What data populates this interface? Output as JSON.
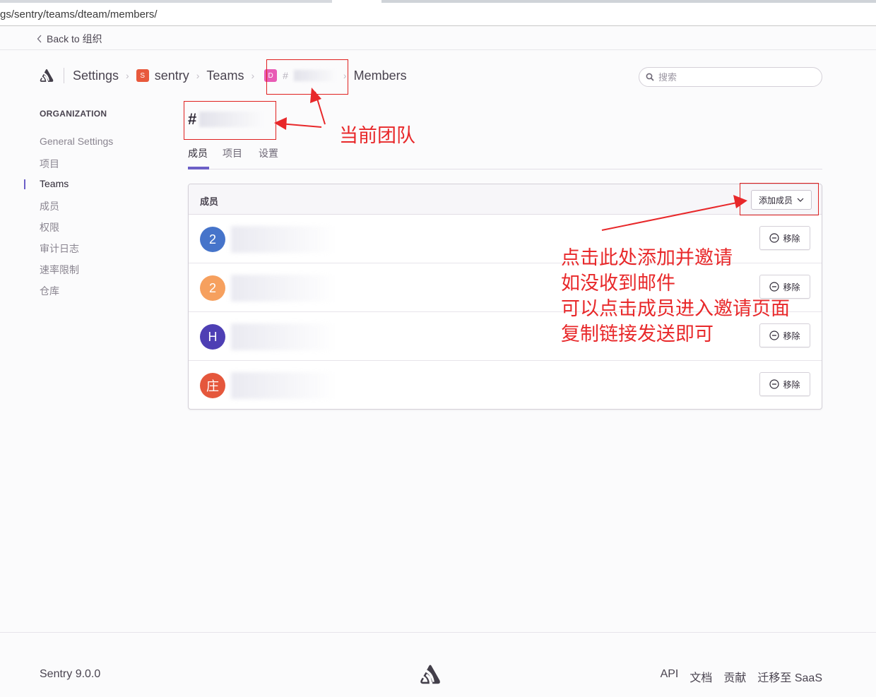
{
  "browser": {
    "url": "gs/sentry/teams/dteam/members/"
  },
  "backbar": {
    "label": "Back to 组织"
  },
  "breadcrumb": {
    "settings": "Settings",
    "org_badge": "S",
    "org": "sentry",
    "teams": "Teams",
    "team_badge": "D",
    "team_hash": "#",
    "members": "Members"
  },
  "search": {
    "placeholder": "搜索"
  },
  "sidebar": {
    "heading": "ORGANIZATION",
    "items": [
      {
        "label": "General Settings",
        "active": false
      },
      {
        "label": "项目",
        "active": false
      },
      {
        "label": "Teams",
        "active": true
      },
      {
        "label": "成员",
        "active": false
      },
      {
        "label": "权限",
        "active": false
      },
      {
        "label": "审计日志",
        "active": false
      },
      {
        "label": "速率限制",
        "active": false
      },
      {
        "label": "仓库",
        "active": false
      }
    ]
  },
  "team": {
    "title": "#",
    "tabs": [
      {
        "label": "成员",
        "active": true
      },
      {
        "label": "项目",
        "active": false
      },
      {
        "label": "设置",
        "active": false
      }
    ]
  },
  "members_panel": {
    "title": "成员",
    "add_button": "添加成员",
    "remove_label": "移除",
    "rows": [
      {
        "initial": "2",
        "color": "#4674ca"
      },
      {
        "initial": "2",
        "color": "#f6a05e"
      },
      {
        "initial": "H",
        "color": "#4e3fb4"
      },
      {
        "initial": "庄",
        "color": "#e5573c"
      }
    ]
  },
  "annotations": {
    "current_team": "当前团队",
    "instructions": [
      "点击此处添加并邀请",
      "如没收到邮件",
      "可以点击成员进入邀请页面",
      "复制链接发送即可"
    ],
    "color": "#e8282a"
  },
  "footer": {
    "version": "Sentry 9.0.0",
    "links": [
      "API",
      "文档",
      "贡献",
      "迁移至 SaaS"
    ]
  },
  "colors": {
    "accent": "#6c5fc7",
    "border": "#d4d0d8",
    "text": "#2f2936"
  }
}
